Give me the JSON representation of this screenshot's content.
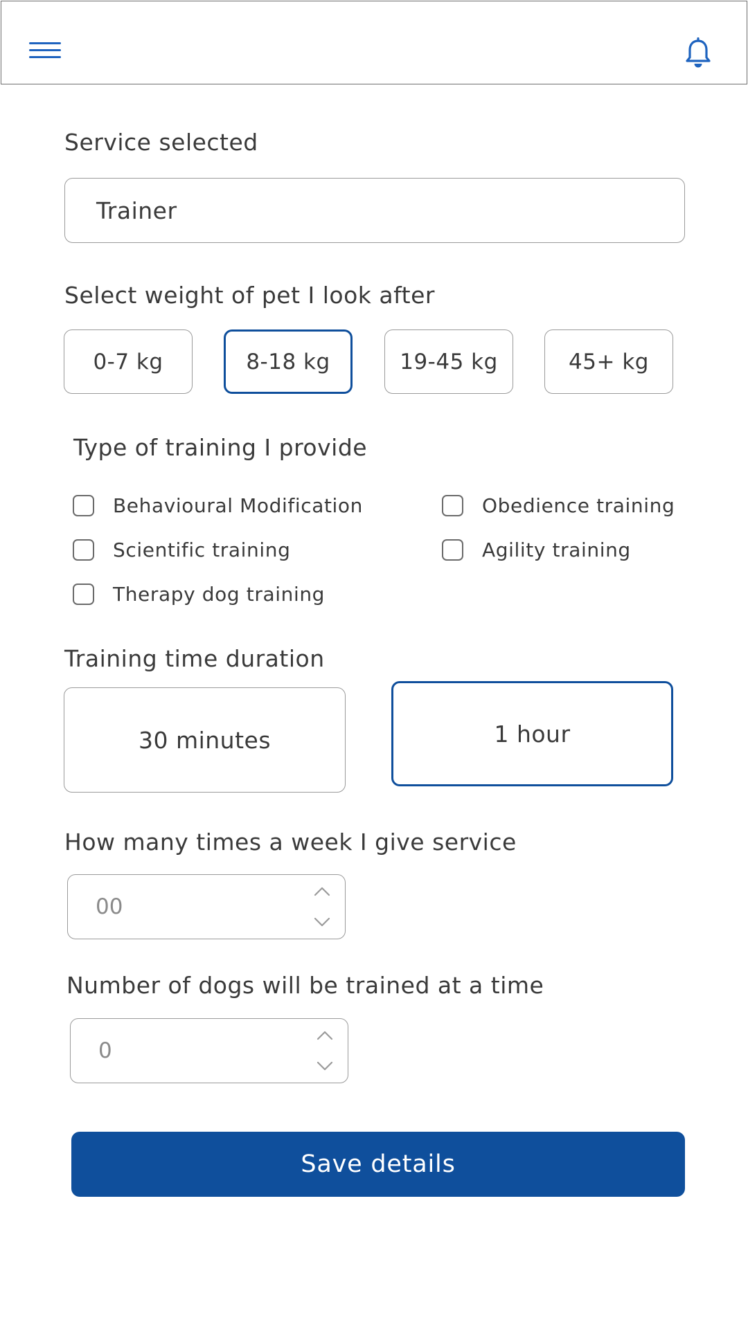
{
  "header": {
    "menu_icon": "hamburger-menu-icon",
    "bell_icon": "bell-icon",
    "accent_color": "#1e63bf"
  },
  "service": {
    "label": "Service selected",
    "value": "Trainer"
  },
  "weight": {
    "label": "Select weight of pet I look after",
    "options": [
      "0-7 kg",
      "8-18 kg",
      "19-45 kg",
      "45+ kg"
    ],
    "selected": "8-18 kg"
  },
  "training_types": {
    "label": "Type of training I provide",
    "options": [
      {
        "label": "Behavioural Modification",
        "checked": false
      },
      {
        "label": "Obedience training",
        "checked": false
      },
      {
        "label": "Scientific training",
        "checked": false
      },
      {
        "label": "Agility training",
        "checked": false
      },
      {
        "label": "Therapy dog training",
        "checked": false
      }
    ]
  },
  "duration": {
    "label": "Training time duration",
    "options": [
      "30 minutes",
      "1 hour"
    ],
    "selected": "1 hour"
  },
  "times_per_week": {
    "label": "How many times a week I give service",
    "value": "00"
  },
  "dogs_at_a_time": {
    "label": "Number of dogs will be trained at a time",
    "value": "0"
  },
  "save_button": {
    "label": "Save details",
    "color": "#0f4f9c"
  }
}
